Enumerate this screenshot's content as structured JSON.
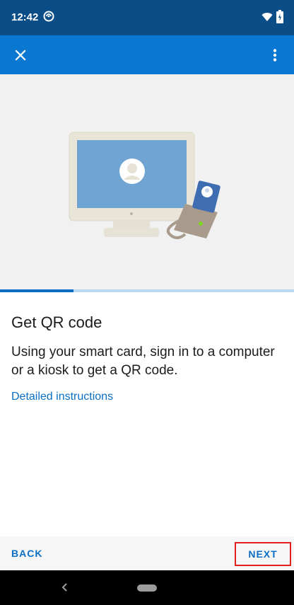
{
  "status_bar": {
    "time": "12:42",
    "icons": [
      "sync-icon",
      "wifi-icon",
      "battery-icon"
    ]
  },
  "app_bar": {
    "close_icon": "close-icon",
    "more_icon": "more-vertical-icon",
    "color": "#0a78d0"
  },
  "hero": {
    "illustration": "monitor-with-smart-card-reader"
  },
  "progress": {
    "fraction": 0.25
  },
  "step": {
    "title": "Get QR code",
    "description": "Using your smart card, sign in to a computer or a kiosk to get a QR code.",
    "link": "Detailed instructions"
  },
  "bottom_bar": {
    "back_label": "BACK",
    "next_label": "NEXT"
  },
  "colors": {
    "status_bar": "#0b4d87",
    "accent": "#0a6fc4",
    "highlight": "#e52222"
  }
}
